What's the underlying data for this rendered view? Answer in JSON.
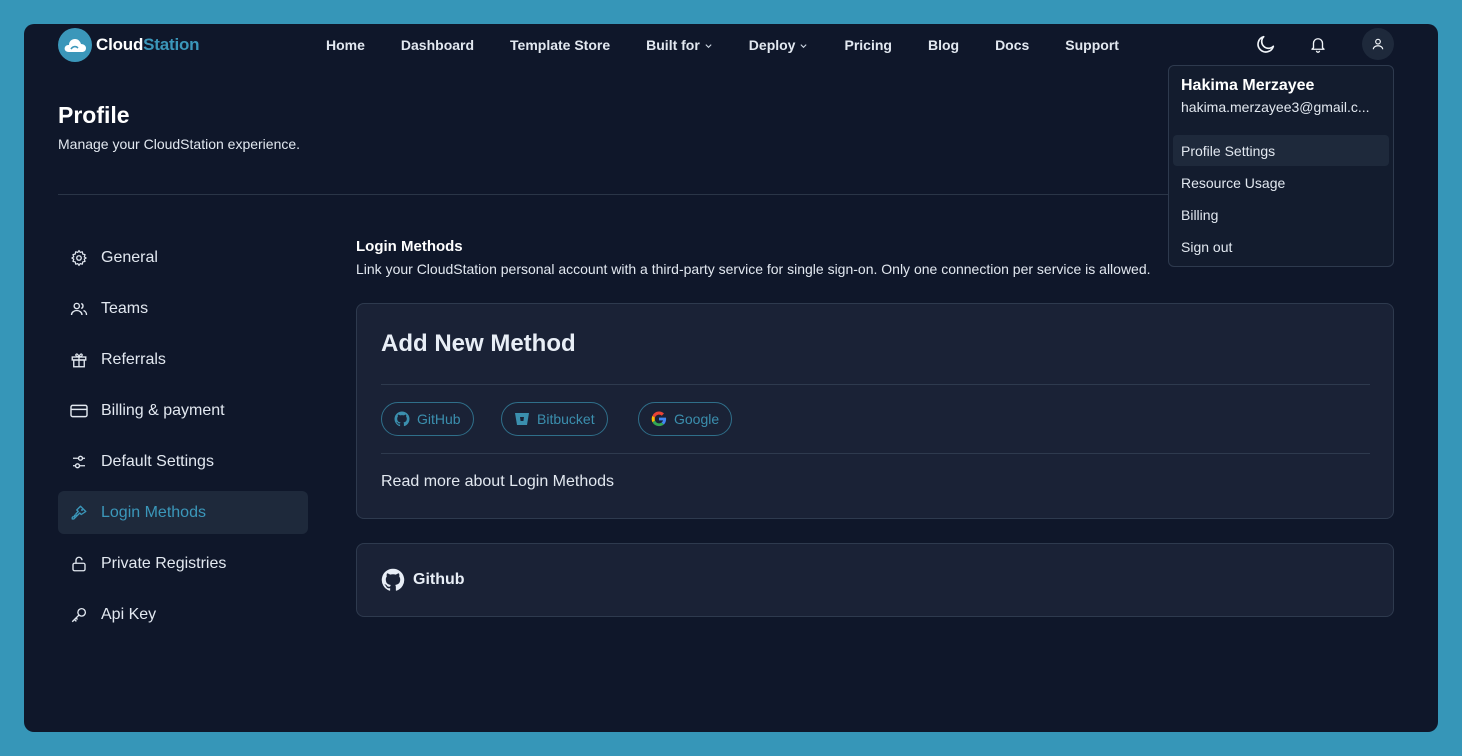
{
  "brand": {
    "name_part1": "Cloud",
    "name_part2": "Station"
  },
  "nav": {
    "items": [
      {
        "label": "Home",
        "has_menu": false
      },
      {
        "label": "Dashboard",
        "has_menu": false
      },
      {
        "label": "Template Store",
        "has_menu": false
      },
      {
        "label": "Built for",
        "has_menu": true
      },
      {
        "label": "Deploy",
        "has_menu": true
      },
      {
        "label": "Pricing",
        "has_menu": false
      },
      {
        "label": "Blog",
        "has_menu": false
      },
      {
        "label": "Docs",
        "has_menu": false
      },
      {
        "label": "Support",
        "has_menu": false
      }
    ],
    "icons": [
      "moon-icon",
      "bell-icon",
      "user-icon"
    ]
  },
  "page": {
    "title": "Profile",
    "subtitle": "Manage your CloudStation experience."
  },
  "sidebar": {
    "items": [
      {
        "label": "General",
        "icon": "gear-icon",
        "active": false
      },
      {
        "label": "Teams",
        "icon": "users-icon",
        "active": false
      },
      {
        "label": "Referrals",
        "icon": "gift-icon",
        "active": false
      },
      {
        "label": "Billing & payment",
        "icon": "credit-card-icon",
        "active": false
      },
      {
        "label": "Default Settings",
        "icon": "sliders-icon",
        "active": false
      },
      {
        "label": "Login Methods",
        "icon": "key-icon",
        "active": true
      },
      {
        "label": "Private Registries",
        "icon": "lock-icon",
        "active": false
      },
      {
        "label": "Api Key",
        "icon": "key-icon",
        "active": false
      }
    ]
  },
  "login_methods": {
    "title": "Login Methods",
    "description": "Link your CloudStation personal account with a third-party service for single sign-on. Only one connection per service is allowed.",
    "add_card": {
      "title": "Add New Method",
      "providers": [
        {
          "label": "GitHub",
          "icon": "github-icon"
        },
        {
          "label": "Bitbucket",
          "icon": "bitbucket-icon"
        },
        {
          "label": "Google",
          "icon": "google-icon"
        }
      ],
      "read_more": "Read more about Login Methods"
    },
    "connected": {
      "label": "Github",
      "icon": "github-icon"
    }
  },
  "user_menu": {
    "name": "Hakima Merzayee",
    "email": "hakima.merzayee3@gmail.c...",
    "items": [
      {
        "label": "Profile Settings",
        "highlighted": true
      },
      {
        "label": "Resource Usage",
        "highlighted": false
      },
      {
        "label": "Billing",
        "highlighted": false
      },
      {
        "label": "Sign out",
        "highlighted": false
      }
    ]
  },
  "colors": {
    "frame": "#3696b8",
    "background": "#0f172a",
    "card": "#1a2236",
    "accent": "#3b97ba"
  }
}
